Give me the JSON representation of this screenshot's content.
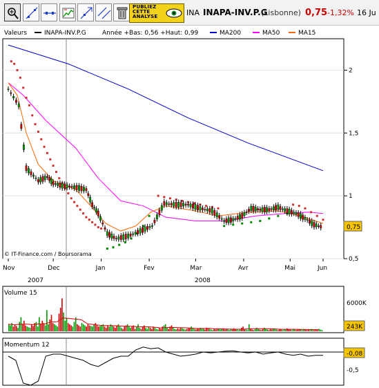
{
  "toolbar": {
    "buttons": [
      {
        "name": "zoom-tool-button",
        "icon": "magnifier-icon"
      },
      {
        "name": "line-tool-button",
        "icon": "diagonal-line-icon"
      },
      {
        "name": "horizontal-line-button",
        "icon": "horizontal-line-icon"
      },
      {
        "name": "indicators-button",
        "icon": "chart-check-icon"
      },
      {
        "name": "trend-tool-button",
        "icon": "trend-arrow-icon"
      },
      {
        "name": "parallel-lines-button",
        "icon": "parallel-lines-icon"
      },
      {
        "name": "delete-button",
        "icon": "trash-icon"
      }
    ],
    "ad_lines": [
      "PUBLIEZ",
      "CETTE",
      "ANALYSE"
    ]
  },
  "quote": {
    "short": "INA",
    "symbol": "INAPA-INV.P.G",
    "market": "(Lisbonne)",
    "price": "0,75",
    "change": "-1,32%",
    "date": "16 Ju"
  },
  "colors": {
    "ma200": "#0000cc",
    "ma50": "#ff00ff",
    "ma15": "#ff6600",
    "up": "#009900",
    "down": "#cc0000",
    "sar_up": "#008800",
    "sar_down": "#cc3333",
    "volume_avg": "#cc0000",
    "momentum": "#000000"
  },
  "chart_data": [
    {
      "type": "line",
      "title": "",
      "legend": [
        "Valeurs",
        "INAPA-INV.P.G",
        "Année +Bas: 0,56 +Haut: 0,99",
        "MA200",
        "MA50",
        "MA15"
      ],
      "x_ticks": [
        "Nov",
        "Dec",
        "Jan",
        "Fev",
        "Mar",
        "Avr",
        "Mai",
        "Jun"
      ],
      "x_years": [
        "2007",
        "2008"
      ],
      "y_ticks": [
        "2",
        "1,5",
        "1",
        "0,5"
      ],
      "ylim": [
        0.5,
        2.25
      ],
      "last_label": "0,75",
      "watermark": "© IT-Finance.com / Boursorama",
      "x": [
        0,
        7,
        12,
        20,
        26,
        30,
        36,
        44,
        52,
        56,
        60,
        66,
        72,
        80,
        88,
        96,
        104,
        112,
        120,
        128,
        136,
        144,
        150,
        156,
        162,
        168,
        174,
        180,
        186,
        192,
        198,
        204,
        210
      ],
      "close": [
        1.85,
        1.72,
        1.22,
        1.12,
        1.15,
        1.1,
        1.08,
        1.07,
        1.05,
        0.93,
        0.86,
        0.7,
        0.66,
        0.68,
        0.72,
        0.76,
        0.94,
        0.93,
        0.93,
        0.9,
        0.88,
        0.8,
        0.81,
        0.84,
        0.9,
        0.89,
        0.89,
        0.91,
        0.88,
        0.86,
        0.82,
        0.77,
        0.75
      ],
      "series": [
        {
          "name": "MA200",
          "x": [
            0,
            40,
            80,
            120,
            160,
            210
          ],
          "values": [
            2.2,
            2.05,
            1.85,
            1.62,
            1.42,
            1.2
          ]
        },
        {
          "name": "MA50",
          "x": [
            0,
            10,
            25,
            45,
            60,
            75,
            90,
            105,
            125,
            145,
            165,
            185,
            200,
            210
          ],
          "values": [
            1.9,
            1.8,
            1.6,
            1.38,
            1.14,
            0.96,
            0.92,
            0.83,
            0.8,
            0.8,
            0.84,
            0.86,
            0.87,
            0.86
          ]
        },
        {
          "name": "MA15",
          "x": [
            0,
            6,
            12,
            20,
            30,
            45,
            55,
            65,
            75,
            85,
            95,
            105,
            125,
            140,
            160,
            180,
            195,
            210
          ],
          "values": [
            1.9,
            1.8,
            1.5,
            1.25,
            1.12,
            1.05,
            0.92,
            0.78,
            0.72,
            0.76,
            0.87,
            0.92,
            0.88,
            0.84,
            0.87,
            0.88,
            0.84,
            0.78
          ]
        }
      ]
    },
    {
      "type": "bar",
      "title": "Volume 15",
      "y_ticks": [
        "6000K"
      ],
      "last_label": "243K",
      "values": [
        60,
        50,
        70,
        40,
        55,
        45,
        30,
        80,
        120,
        60,
        90,
        50,
        40,
        35,
        30,
        60,
        45,
        70,
        80,
        40,
        120,
        60,
        90,
        70,
        50,
        180,
        60,
        100,
        140,
        70,
        60,
        50,
        40,
        150,
        200,
        280,
        160,
        90,
        110,
        70,
        60,
        50,
        40,
        80,
        120,
        60,
        50,
        40,
        70,
        60,
        50,
        40,
        60,
        50,
        45,
        40,
        60,
        70,
        50,
        40,
        45,
        50,
        60,
        40,
        30,
        50,
        40,
        60,
        50,
        40,
        30,
        50,
        60,
        40,
        30,
        20,
        40,
        50,
        60,
        40,
        30,
        40,
        50,
        20,
        40,
        60,
        30,
        20,
        40,
        50,
        30,
        20,
        40,
        30,
        20,
        40,
        30,
        20,
        15,
        30,
        20,
        40,
        50,
        60,
        30,
        20,
        40,
        50,
        30,
        20,
        15,
        25,
        20,
        30,
        25,
        20,
        15,
        20,
        25,
        30,
        40,
        30,
        20,
        15,
        25,
        20,
        30,
        25,
        20,
        15,
        30,
        25,
        20,
        15,
        10,
        20,
        15,
        25,
        20,
        15,
        20,
        25,
        15,
        20,
        15,
        10,
        20,
        15,
        25,
        20,
        15,
        10,
        20,
        30,
        40,
        20,
        15,
        10,
        60,
        20,
        15,
        10,
        20,
        30,
        20,
        15,
        10,
        20,
        30,
        20,
        15,
        10,
        20,
        15,
        25,
        20,
        15,
        10,
        20,
        15,
        10,
        20,
        15,
        25,
        20,
        15,
        10,
        20,
        15,
        10,
        15,
        20,
        15,
        10,
        20,
        15,
        10,
        15,
        10,
        20,
        15,
        10,
        15,
        10,
        20,
        15,
        10
      ]
    },
    {
      "type": "line",
      "title": "Momentum 12",
      "y_ticks": [
        "-0,5"
      ],
      "last_label": "-0,08",
      "x": [
        0,
        5,
        10,
        15,
        20,
        25,
        30,
        35,
        40,
        45,
        50,
        55,
        60,
        65,
        70,
        75,
        80,
        85,
        90,
        95,
        100,
        105,
        110,
        115,
        120,
        125,
        130,
        135,
        140,
        145,
        150,
        155,
        160,
        165,
        170,
        175,
        180,
        185,
        190,
        195,
        200,
        205,
        210
      ],
      "values": [
        -0.1,
        -0.2,
        -0.75,
        -0.8,
        -0.7,
        -0.1,
        -0.05,
        -0.05,
        -0.1,
        -0.15,
        -0.2,
        -0.3,
        -0.35,
        -0.25,
        -0.15,
        -0.1,
        -0.1,
        0.05,
        0.12,
        0.08,
        0.1,
        0.0,
        -0.05,
        -0.1,
        -0.08,
        -0.05,
        0.0,
        -0.02,
        0.0,
        0.02,
        0.03,
        0.0,
        -0.02,
        0.0,
        -0.05,
        -0.02,
        0.0,
        -0.05,
        -0.08,
        -0.05,
        -0.1,
        -0.08,
        -0.08
      ]
    }
  ]
}
